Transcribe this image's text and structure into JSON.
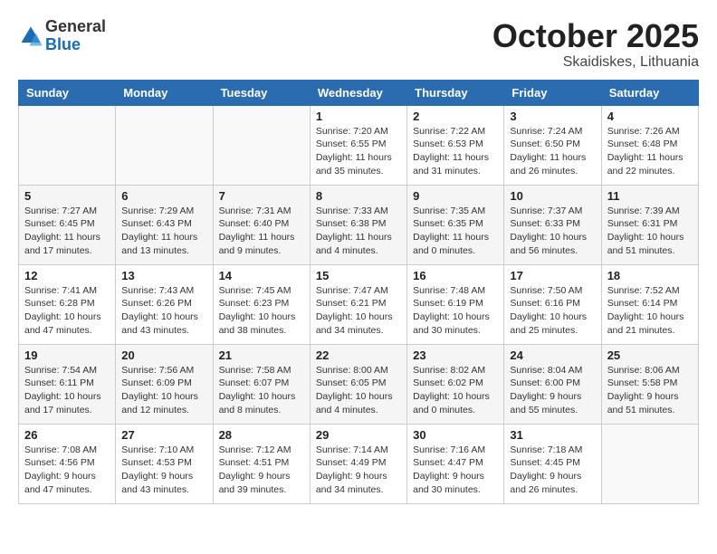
{
  "logo": {
    "general": "General",
    "blue": "Blue"
  },
  "title": "October 2025",
  "location": "Skaidiskes, Lithuania",
  "headers": [
    "Sunday",
    "Monday",
    "Tuesday",
    "Wednesday",
    "Thursday",
    "Friday",
    "Saturday"
  ],
  "weeks": [
    [
      {
        "day": "",
        "info": ""
      },
      {
        "day": "",
        "info": ""
      },
      {
        "day": "",
        "info": ""
      },
      {
        "day": "1",
        "info": "Sunrise: 7:20 AM\nSunset: 6:55 PM\nDaylight: 11 hours\nand 35 minutes."
      },
      {
        "day": "2",
        "info": "Sunrise: 7:22 AM\nSunset: 6:53 PM\nDaylight: 11 hours\nand 31 minutes."
      },
      {
        "day": "3",
        "info": "Sunrise: 7:24 AM\nSunset: 6:50 PM\nDaylight: 11 hours\nand 26 minutes."
      },
      {
        "day": "4",
        "info": "Sunrise: 7:26 AM\nSunset: 6:48 PM\nDaylight: 11 hours\nand 22 minutes."
      }
    ],
    [
      {
        "day": "5",
        "info": "Sunrise: 7:27 AM\nSunset: 6:45 PM\nDaylight: 11 hours\nand 17 minutes."
      },
      {
        "day": "6",
        "info": "Sunrise: 7:29 AM\nSunset: 6:43 PM\nDaylight: 11 hours\nand 13 minutes."
      },
      {
        "day": "7",
        "info": "Sunrise: 7:31 AM\nSunset: 6:40 PM\nDaylight: 11 hours\nand 9 minutes."
      },
      {
        "day": "8",
        "info": "Sunrise: 7:33 AM\nSunset: 6:38 PM\nDaylight: 11 hours\nand 4 minutes."
      },
      {
        "day": "9",
        "info": "Sunrise: 7:35 AM\nSunset: 6:35 PM\nDaylight: 11 hours\nand 0 minutes."
      },
      {
        "day": "10",
        "info": "Sunrise: 7:37 AM\nSunset: 6:33 PM\nDaylight: 10 hours\nand 56 minutes."
      },
      {
        "day": "11",
        "info": "Sunrise: 7:39 AM\nSunset: 6:31 PM\nDaylight: 10 hours\nand 51 minutes."
      }
    ],
    [
      {
        "day": "12",
        "info": "Sunrise: 7:41 AM\nSunset: 6:28 PM\nDaylight: 10 hours\nand 47 minutes."
      },
      {
        "day": "13",
        "info": "Sunrise: 7:43 AM\nSunset: 6:26 PM\nDaylight: 10 hours\nand 43 minutes."
      },
      {
        "day": "14",
        "info": "Sunrise: 7:45 AM\nSunset: 6:23 PM\nDaylight: 10 hours\nand 38 minutes."
      },
      {
        "day": "15",
        "info": "Sunrise: 7:47 AM\nSunset: 6:21 PM\nDaylight: 10 hours\nand 34 minutes."
      },
      {
        "day": "16",
        "info": "Sunrise: 7:48 AM\nSunset: 6:19 PM\nDaylight: 10 hours\nand 30 minutes."
      },
      {
        "day": "17",
        "info": "Sunrise: 7:50 AM\nSunset: 6:16 PM\nDaylight: 10 hours\nand 25 minutes."
      },
      {
        "day": "18",
        "info": "Sunrise: 7:52 AM\nSunset: 6:14 PM\nDaylight: 10 hours\nand 21 minutes."
      }
    ],
    [
      {
        "day": "19",
        "info": "Sunrise: 7:54 AM\nSunset: 6:11 PM\nDaylight: 10 hours\nand 17 minutes."
      },
      {
        "day": "20",
        "info": "Sunrise: 7:56 AM\nSunset: 6:09 PM\nDaylight: 10 hours\nand 12 minutes."
      },
      {
        "day": "21",
        "info": "Sunrise: 7:58 AM\nSunset: 6:07 PM\nDaylight: 10 hours\nand 8 minutes."
      },
      {
        "day": "22",
        "info": "Sunrise: 8:00 AM\nSunset: 6:05 PM\nDaylight: 10 hours\nand 4 minutes."
      },
      {
        "day": "23",
        "info": "Sunrise: 8:02 AM\nSunset: 6:02 PM\nDaylight: 10 hours\nand 0 minutes."
      },
      {
        "day": "24",
        "info": "Sunrise: 8:04 AM\nSunset: 6:00 PM\nDaylight: 9 hours\nand 55 minutes."
      },
      {
        "day": "25",
        "info": "Sunrise: 8:06 AM\nSunset: 5:58 PM\nDaylight: 9 hours\nand 51 minutes."
      }
    ],
    [
      {
        "day": "26",
        "info": "Sunrise: 7:08 AM\nSunset: 4:56 PM\nDaylight: 9 hours\nand 47 minutes."
      },
      {
        "day": "27",
        "info": "Sunrise: 7:10 AM\nSunset: 4:53 PM\nDaylight: 9 hours\nand 43 minutes."
      },
      {
        "day": "28",
        "info": "Sunrise: 7:12 AM\nSunset: 4:51 PM\nDaylight: 9 hours\nand 39 minutes."
      },
      {
        "day": "29",
        "info": "Sunrise: 7:14 AM\nSunset: 4:49 PM\nDaylight: 9 hours\nand 34 minutes."
      },
      {
        "day": "30",
        "info": "Sunrise: 7:16 AM\nSunset: 4:47 PM\nDaylight: 9 hours\nand 30 minutes."
      },
      {
        "day": "31",
        "info": "Sunrise: 7:18 AM\nSunset: 4:45 PM\nDaylight: 9 hours\nand 26 minutes."
      },
      {
        "day": "",
        "info": ""
      }
    ]
  ]
}
